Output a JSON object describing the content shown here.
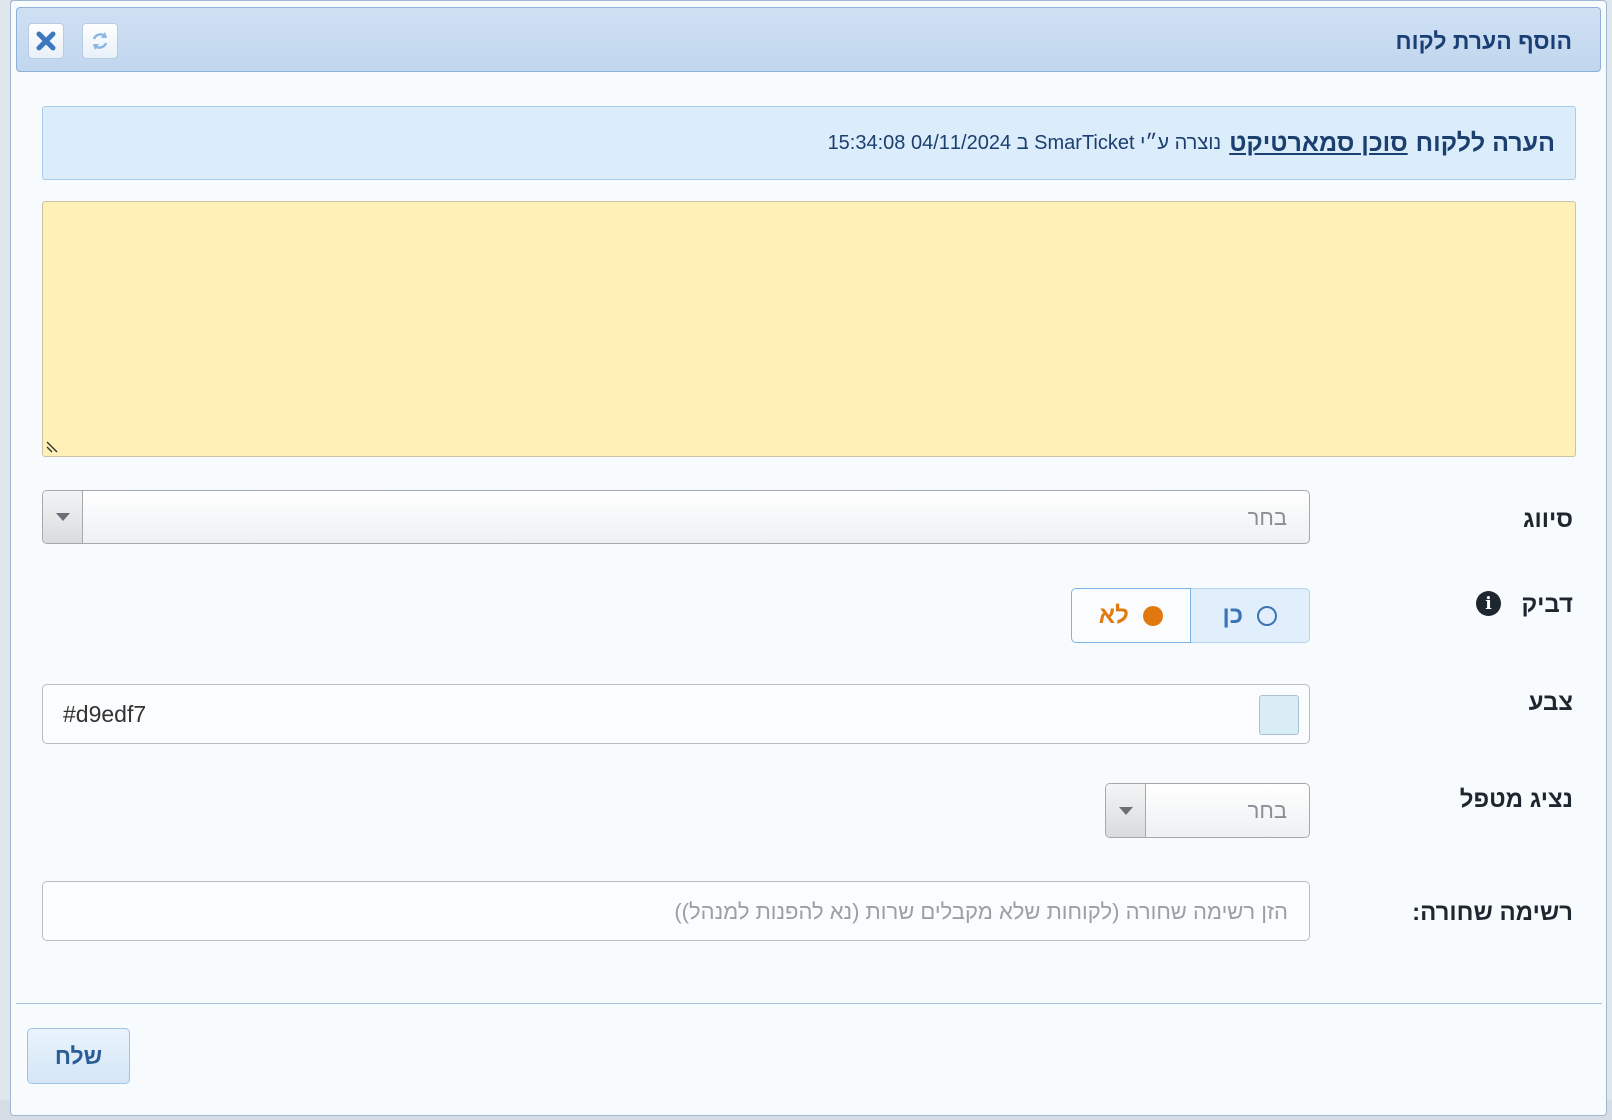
{
  "dialog": {
    "title": "הוסף הערת לקוח"
  },
  "info": {
    "prefix": "הערה ללקוח",
    "customer_link": "סוכן סמארטיקט",
    "meta": "נוצרה ע״י SmarTicket ב 04/11/2024 15:34:08"
  },
  "note": {
    "value": ""
  },
  "fields": {
    "tag_label": "סיווג",
    "tag_value": "בחר",
    "sticky_label": "דביק",
    "sticky_yes": "כן",
    "sticky_no": "לא",
    "sticky_selected": "לא",
    "color_label": "צבע",
    "color_value": "#d9edf7",
    "agent_label": "נציג מטפל",
    "agent_value": "בחר",
    "blacklist_label": "רשימה שחורה:",
    "blacklist_placeholder": "הזן רשימה שחורה (לקוחות שלא מקבלים שרות (נא להפנות למנהל))"
  },
  "footer": {
    "send_label": "שלח"
  },
  "colors": {
    "accent": "#1a3f75",
    "note_bg": "#fff0b8",
    "info_bg": "#dbecfb",
    "selected_orange": "#e0790f",
    "swatch": "#d9edf7"
  },
  "icons": [
    "close-icon",
    "refresh-icon",
    "info-icon",
    "chevron-down-icon",
    "resize-grip-icon"
  ]
}
